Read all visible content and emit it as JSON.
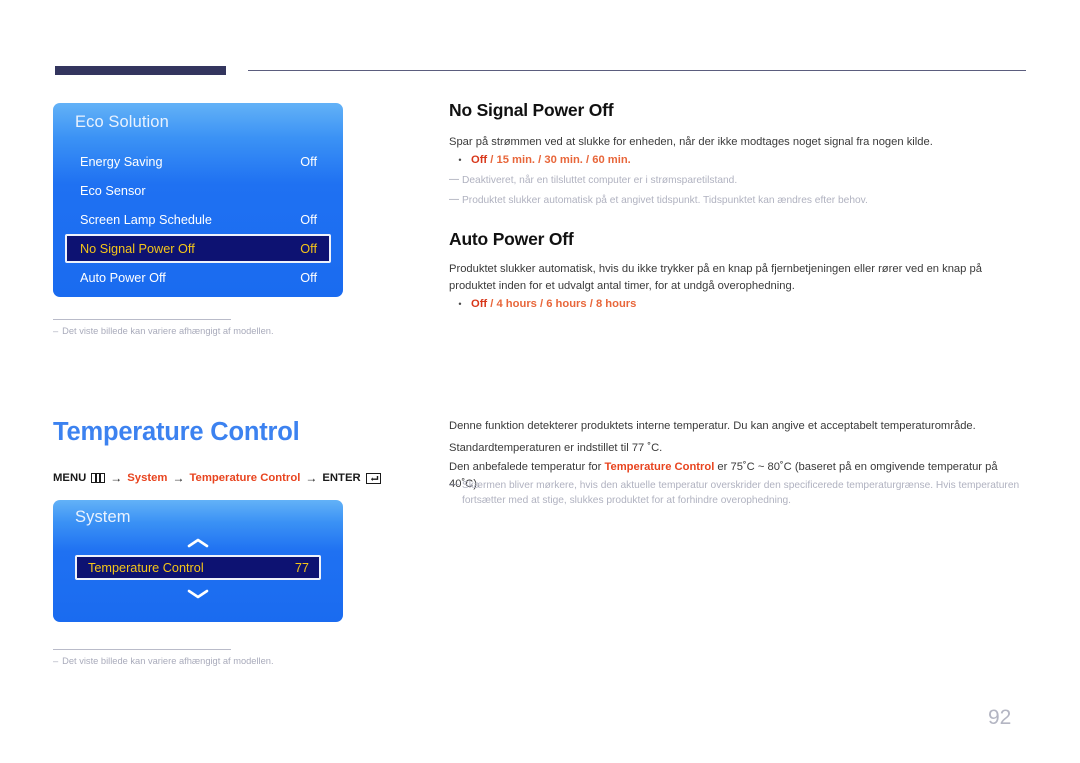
{
  "page": {
    "number": "92",
    "section_title": "Temperature Control"
  },
  "breadcrumb": {
    "menu_label": "MENU",
    "menu_icon": "menu-bars-icon",
    "arrow": "→",
    "path1": "System",
    "path2": "Temperature Control",
    "enter_label": "ENTER",
    "enter_icon": "enter-return-icon"
  },
  "osd_eco": {
    "title": "Eco Solution",
    "rows": [
      {
        "label": "Energy Saving",
        "value": "Off",
        "selected": false
      },
      {
        "label": "Eco Sensor",
        "value": "",
        "selected": false
      },
      {
        "label": "Screen Lamp Schedule",
        "value": "Off",
        "selected": false
      },
      {
        "label": "No Signal Power Off",
        "value": "Off",
        "selected": true
      },
      {
        "label": "Auto Power Off",
        "value": "Off",
        "selected": false
      }
    ],
    "note": "Det viste billede kan variere afhængigt af modellen.",
    "note_dash": "–"
  },
  "osd_system": {
    "title": "System",
    "chevron_up": "chevron-up-icon",
    "chevron_down": "chevron-down-icon",
    "row": {
      "label": "Temperature Control",
      "value": "77",
      "selected": true
    },
    "note": "Det viste billede kan variere afhængigt af modellen.",
    "note_dash": "–"
  },
  "topics": {
    "no_signal_power_off": {
      "title": "No Signal Power Off",
      "description": "Spar på strømmen ved at slukke for enheden, når der ikke modtages noget signal fra nogen kilde.",
      "bullet_dot": "•",
      "option_first": "Off",
      "option_rest": " / 15 min. / 30 min. / 60 min.",
      "note_dash": "—",
      "note1": "Deaktiveret, når en tilsluttet computer er i strømsparetilstand.",
      "note2": "Produktet slukker automatisk på et angivet tidspunkt. Tidspunktet kan ændres efter behov."
    },
    "auto_power_off": {
      "title": "Auto Power Off",
      "description": "Produktet slukker automatisk, hvis du ikke trykker på en knap på fjernbetjeningen eller rører ved en knap på produktet inden for et udvalgt antal timer, for at undgå overophedning.",
      "bullet_dot": "•",
      "option_first": "Off",
      "option_rest": " / 4 hours / 6 hours / 8 hours"
    },
    "temperature_control": {
      "line1": "Denne funktion detekterer produktets interne temperatur. Du kan angive et acceptabelt temperaturområde.",
      "line2": "Standardtemperaturen er indstillet til 77 ˚C.",
      "line3_part1": "Den anbefalede temperatur for ",
      "line3_accent": "Temperature Control",
      "line3_part2": " er 75˚C ~ 80˚C (baseret på en omgivende temperatur på 40˚C).",
      "note_dash": "—",
      "note1": "Skærmen bliver mørkere, hvis den aktuelle temperatur overskrider den specificerede temperaturgrænse. Hvis temperaturen fortsætter med at stige, slukkes produktet for at forhindre overophedning."
    }
  },
  "colors": {
    "accent_blue": "#3c82f0",
    "accent_red": "#e8441f",
    "osd_blue": "#1a6bf0",
    "osd_selected": "#0d1272",
    "osd_selected_text": "#f5c518",
    "header_bar": "#33355e"
  }
}
